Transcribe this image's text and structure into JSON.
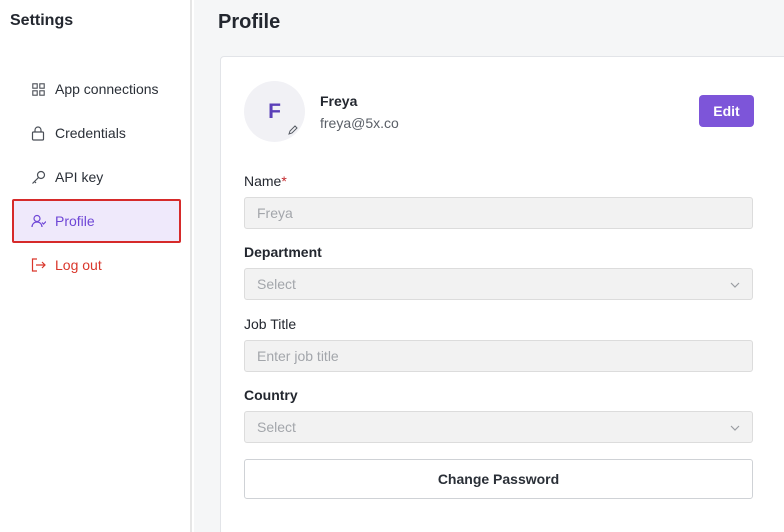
{
  "sidebar": {
    "title": "Settings",
    "items": [
      {
        "label": "App connections",
        "icon": "grid-icon"
      },
      {
        "label": "Credentials",
        "icon": "lock-icon"
      },
      {
        "label": "API key",
        "icon": "key-icon"
      },
      {
        "label": "Profile",
        "icon": "user-icon",
        "active": true
      },
      {
        "label": "Log out",
        "icon": "logout-icon"
      }
    ]
  },
  "page": {
    "title": "Profile"
  },
  "profile": {
    "avatar_initial": "F",
    "name": "Freya",
    "email": "freya@5x.co",
    "edit_label": "Edit"
  },
  "form": {
    "name": {
      "label": "Name",
      "required_mark": "*",
      "value": "Freya"
    },
    "department": {
      "label": "Department",
      "placeholder": "Select"
    },
    "job_title": {
      "label": "Job Title",
      "placeholder": "Enter job title"
    },
    "country": {
      "label": "Country",
      "placeholder": "Select"
    },
    "change_password_label": "Change Password"
  },
  "colors": {
    "accent": "#7d55d9",
    "active_bg": "#efe9fb",
    "logout": "#d9362b",
    "highlight_border": "#d62a2a"
  }
}
